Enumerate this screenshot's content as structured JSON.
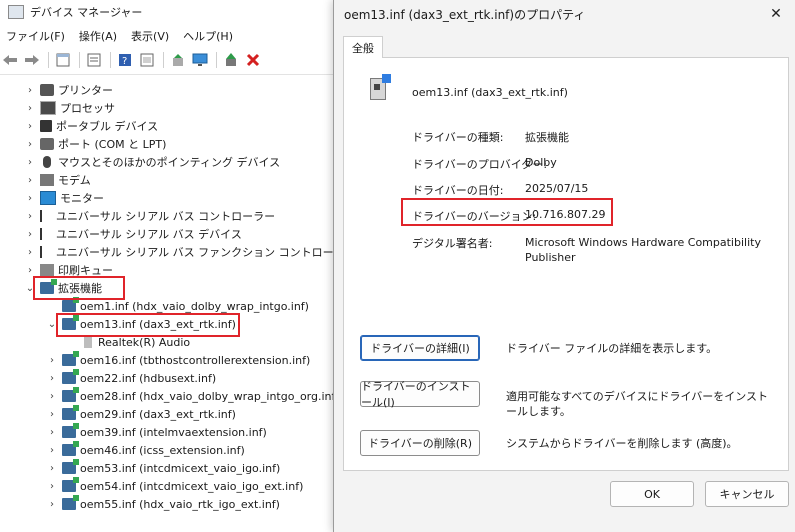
{
  "dm": {
    "title": "デバイス マネージャー",
    "menu": [
      "ファイル(F)",
      "操作(A)",
      "表示(V)",
      "ヘルプ(H)"
    ],
    "toolbar_icons": [
      "back-arrow-icon",
      "forward-arrow-icon",
      "properties-grid-icon",
      "list-icon",
      "help-icon",
      "details-icon",
      "update-driver-icon",
      "monitor-icon",
      "enable-device-icon",
      "remove-device-icon"
    ],
    "tree": [
      {
        "label": "プリンター",
        "icon": "printer",
        "indent": 0,
        "chev": "›"
      },
      {
        "label": "プロセッサ",
        "icon": "cpu",
        "indent": 0,
        "chev": "›"
      },
      {
        "label": "ポータブル デバイス",
        "icon": "portable",
        "indent": 0,
        "chev": "›"
      },
      {
        "label": "ポート (COM と LPT)",
        "icon": "port",
        "indent": 0,
        "chev": "›"
      },
      {
        "label": "マウスとそのほかのポインティング デバイス",
        "icon": "mouse",
        "indent": 0,
        "chev": "›"
      },
      {
        "label": "モデム",
        "icon": "modem",
        "indent": 0,
        "chev": "›"
      },
      {
        "label": "モニター",
        "icon": "monitor",
        "indent": 0,
        "chev": "›"
      },
      {
        "label": "ユニバーサル シリアル バス コントローラー",
        "icon": "usb",
        "indent": 0,
        "chev": "›"
      },
      {
        "label": "ユニバーサル シリアル バス デバイス",
        "icon": "usb",
        "indent": 0,
        "chev": "›"
      },
      {
        "label": "ユニバーサル シリアル バス ファンクション コントローラー",
        "icon": "usb",
        "indent": 0,
        "chev": "›"
      },
      {
        "label": "印刷キュー",
        "icon": "print",
        "indent": 0,
        "chev": "›"
      },
      {
        "label": "拡張機能",
        "icon": "ext",
        "indent": 0,
        "chev": "⌄"
      },
      {
        "label": "oem1.inf (hdx_vaio_dolby_wrap_intgo.inf)",
        "icon": "ext",
        "indent": 1,
        "chev": ""
      },
      {
        "label": "oem13.inf (dax3_ext_rtk.inf)",
        "icon": "ext",
        "indent": 1,
        "chev": "⌄"
      },
      {
        "label": "Realtek(R) Audio",
        "icon": "speaker",
        "indent": 2,
        "chev": ""
      },
      {
        "label": "oem16.inf (tbthostcontrollerextension.inf)",
        "icon": "ext",
        "indent": 1,
        "chev": "›"
      },
      {
        "label": "oem22.inf (hdbusext.inf)",
        "icon": "ext",
        "indent": 1,
        "chev": "›"
      },
      {
        "label": "oem28.inf (hdx_vaio_dolby_wrap_intgo_org.inf)",
        "icon": "ext",
        "indent": 1,
        "chev": "›"
      },
      {
        "label": "oem29.inf (dax3_ext_rtk.inf)",
        "icon": "ext",
        "indent": 1,
        "chev": "›"
      },
      {
        "label": "oem39.inf (intelmvaextension.inf)",
        "icon": "ext",
        "indent": 1,
        "chev": "›"
      },
      {
        "label": "oem46.inf (icss_extension.inf)",
        "icon": "ext",
        "indent": 1,
        "chev": "›"
      },
      {
        "label": "oem53.inf (intcdmicext_vaio_igo.inf)",
        "icon": "ext",
        "indent": 1,
        "chev": "›"
      },
      {
        "label": "oem54.inf (intcdmicext_vaio_igo_ext.inf)",
        "icon": "ext",
        "indent": 1,
        "chev": "›"
      },
      {
        "label": "oem55.inf (hdx_vaio_rtk_igo_ext.inf)",
        "icon": "ext",
        "indent": 1,
        "chev": "›"
      }
    ]
  },
  "dialog": {
    "title": "oem13.inf (dax3_ext_rtk.inf)のプロパティ",
    "tab": "全般",
    "driver_name": "oem13.inf (dax3_ext_rtk.inf)",
    "props": {
      "type_label": "ドライバーの種類:",
      "type_value": "拡張機能",
      "provider_label": "ドライバーのプロバイダー:",
      "provider_value": "Dolby",
      "date_label": "ドライバーの日付:",
      "date_value": "2025/07/15",
      "version_label": "ドライバーのバージョン:",
      "version_value": "10.716.807.29",
      "signer_label": "デジタル署名者:",
      "signer_value": "Microsoft Windows Hardware Compatibility Publisher"
    },
    "buttons": {
      "details": "ドライバーの詳細(I)",
      "details_desc": "ドライバー ファイルの詳細を表示します。",
      "install": "ドライバーのインストール(I)",
      "install_desc": "適用可能なすべてのデバイスにドライバーをインストールします。",
      "remove": "ドライバーの削除(R)",
      "remove_desc": "システムからドライバーを削除します (高度)。",
      "ok": "OK",
      "cancel": "キャンセル"
    },
    "colors": {
      "highlight": "#e0242a",
      "accent": "#2866b8"
    }
  }
}
